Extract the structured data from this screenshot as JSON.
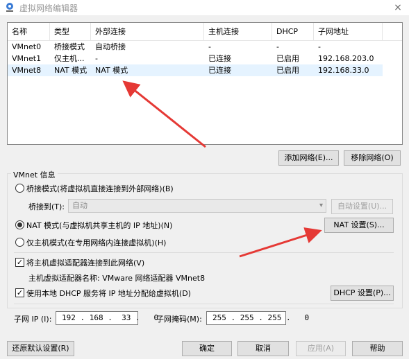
{
  "window": {
    "title": "虚拟网络编辑器",
    "close_icon": "×"
  },
  "table": {
    "columns": [
      "名称",
      "类型",
      "外部连接",
      "主机连接",
      "DHCP",
      "子网地址"
    ],
    "rows": [
      {
        "name": "VMnet0",
        "type": "桥接模式",
        "external": "自动桥接",
        "host": "-",
        "dhcp": "-",
        "subnet": "-"
      },
      {
        "name": "VMnet1",
        "type": "仅主机...",
        "external": "-",
        "host": "已连接",
        "dhcp": "已启用",
        "subnet": "192.168.203.0"
      },
      {
        "name": "VMnet8",
        "type": "NAT 模式",
        "external": "NAT 模式",
        "host": "已连接",
        "dhcp": "已启用",
        "subnet": "192.168.33.0"
      }
    ]
  },
  "buttons": {
    "add_network": "添加网络(E)...",
    "remove_network": "移除网络(O)",
    "auto_settings": "自动设置(U)...",
    "nat_settings": "NAT 设置(S)...",
    "dhcp_settings": "DHCP 设置(P)...",
    "restore_defaults": "还原默认设置(R)",
    "ok": "确定",
    "cancel": "取消",
    "apply": "应用(A)",
    "help": "帮助"
  },
  "vmnet_info": {
    "label": "VMnet 信息",
    "bridge_mode": "桥接模式(将虚拟机直接连接到外部网络)(B)",
    "bridge_to_label": "桥接到(T):",
    "bridge_to_value": "自动",
    "nat_mode": "NAT 模式(与虚拟机共享主机的 IP 地址)(N)",
    "host_only_mode": "仅主机模式(在专用网络内连接虚拟机)(H)",
    "connect_host_adapter": "将主机虚拟适配器连接到此网络(V)",
    "host_adapter_name": "主机虚拟适配器名称: VMware 网络适配器 VMnet8",
    "use_dhcp": "使用本地 DHCP 服务将 IP 地址分配给虚拟机(D)",
    "selected_mode": "nat",
    "connect_host_adapter_checked": true,
    "use_dhcp_checked": true
  },
  "subnet": {
    "ip_label": "子网 IP (I):",
    "ip_value": "192 . 168 .  33 .   0",
    "mask_label": "子网掩码(M):",
    "mask_value": "255 . 255 . 255 .   0"
  },
  "annotation_color": "#e53935"
}
